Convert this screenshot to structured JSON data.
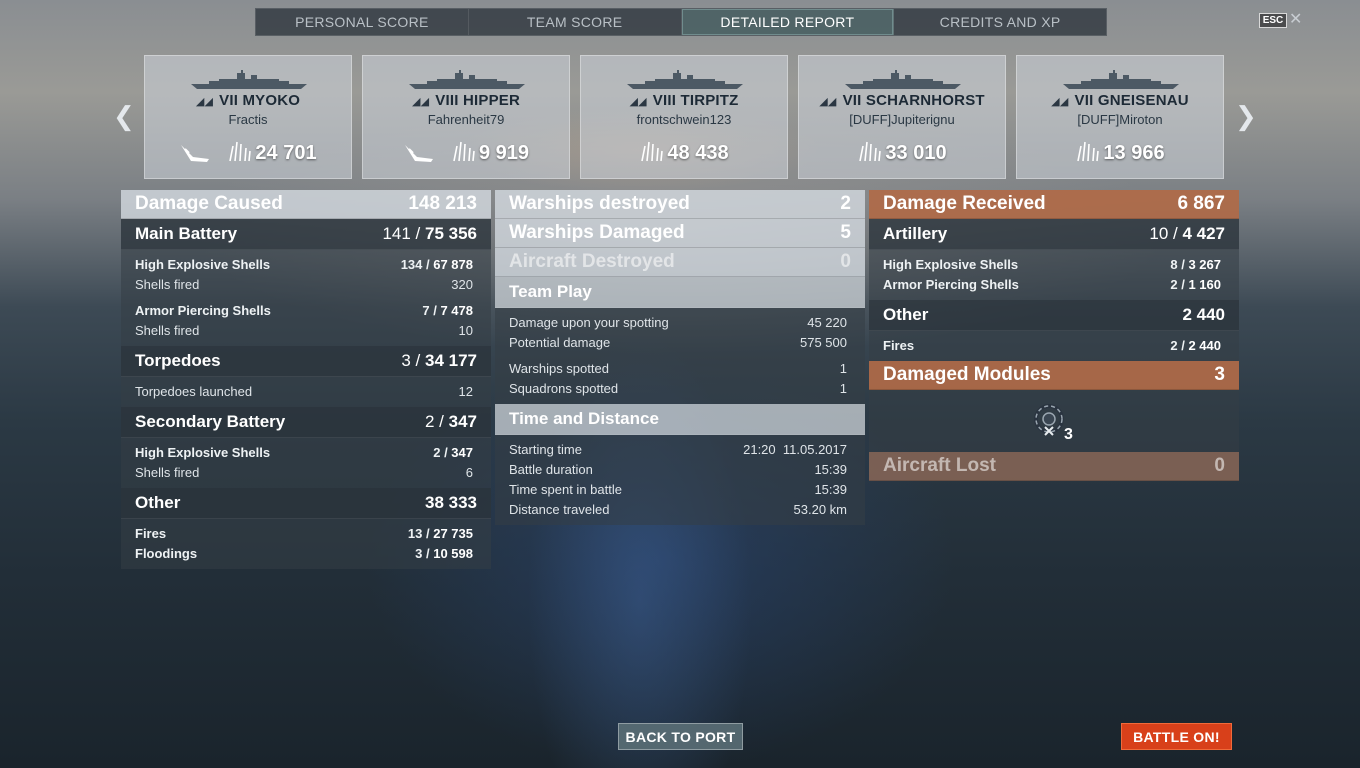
{
  "tabs": [
    {
      "label": "PERSONAL SCORE"
    },
    {
      "label": "TEAM SCORE"
    },
    {
      "label": "DETAILED REPORT"
    },
    {
      "label": "CREDITS AND XP"
    }
  ],
  "header": {
    "esc_label": "ESC",
    "close_glyph": "✕"
  },
  "ships": [
    {
      "tier": "VII",
      "name": "MYOKO",
      "player": "Fractis",
      "damage": "24 701",
      "sunk": true
    },
    {
      "tier": "VIII",
      "name": "HIPPER",
      "player": "Fahrenheit79",
      "damage": "9 919",
      "sunk": true
    },
    {
      "tier": "VIII",
      "name": "TIRPITZ",
      "player": "frontschwein123",
      "damage": "48 438",
      "sunk": false
    },
    {
      "tier": "VII",
      "name": "SCHARNHORST",
      "player": "[DUFF]Jupiterignu",
      "damage": "33 010",
      "sunk": false
    },
    {
      "tier": "VII",
      "name": "GNEISENAU",
      "player": "[DUFF]Miroton",
      "damage": "13 966",
      "sunk": false
    }
  ],
  "damage_caused": {
    "label": "Damage Caused",
    "value": "148 213",
    "main_battery": {
      "label": "Main Battery",
      "hits": "141",
      "value": "75 356",
      "he_label": "High Explosive Shells",
      "he_hits": "134",
      "he_value": "67 878",
      "he_fired_label": "Shells fired",
      "he_fired": "320",
      "ap_label": "Armor Piercing Shells",
      "ap_hits": "7",
      "ap_value": "7 478",
      "ap_fired_label": "Shells fired",
      "ap_fired": "10"
    },
    "torpedoes": {
      "label": "Torpedoes",
      "hits": "3",
      "value": "34 177",
      "launched_label": "Torpedoes launched",
      "launched": "12"
    },
    "secondary": {
      "label": "Secondary Battery",
      "hits": "2",
      "value": "347",
      "he_label": "High Explosive Shells",
      "he_hits": "2",
      "he_value": "347",
      "fired_label": "Shells fired",
      "fired": "6"
    },
    "other": {
      "label": "Other",
      "value": "38 333",
      "fires_label": "Fires",
      "fires_hits": "13",
      "fires_value": "27 735",
      "flood_label": "Floodings",
      "flood_hits": "3",
      "flood_value": "10 598"
    }
  },
  "middle": {
    "warships_destroyed_label": "Warships destroyed",
    "warships_destroyed": "2",
    "warships_damaged_label": "Warships Damaged",
    "warships_damaged": "5",
    "aircraft_destroyed_label": "Aircraft Destroyed",
    "aircraft_destroyed": "0",
    "team_play": {
      "label": "Team Play",
      "spotting_dmg_label": "Damage upon your spotting",
      "spotting_dmg": "45 220",
      "potential_label": "Potential damage",
      "potential": "575 500",
      "ws_spotted_label": "Warships spotted",
      "ws_spotted": "1",
      "sq_spotted_label": "Squadrons spotted",
      "sq_spotted": "1"
    },
    "time_distance": {
      "label": "Time and Distance",
      "start_label": "Starting time",
      "start_time": "21:20",
      "start_date": "11.05.2017",
      "duration_label": "Battle duration",
      "duration": "15:39",
      "spent_label": "Time spent in battle",
      "spent": "15:39",
      "distance_label": "Distance traveled",
      "distance": "53.20 km"
    }
  },
  "damage_received": {
    "label": "Damage Received",
    "value": "6 867",
    "artillery": {
      "label": "Artillery",
      "hits": "10",
      "value": "4 427",
      "he_label": "High Explosive Shells",
      "he_hits": "8",
      "he_value": "3 267",
      "ap_label": "Armor Piercing Shells",
      "ap_hits": "2",
      "ap_value": "1 160"
    },
    "other": {
      "label": "Other",
      "value": "2 440",
      "fires_label": "Fires",
      "fires_hits": "2",
      "fires_value": "2 440"
    },
    "modules": {
      "label": "Damaged Modules",
      "value": "3",
      "icon_count": "3"
    },
    "aircraft_lost": {
      "label": "Aircraft Lost",
      "value": "0"
    }
  },
  "buttons": {
    "back_to_port": "BACK TO PORT",
    "battle_on": "BATTLE ON!"
  },
  "colors": {
    "accent_orange": "#b06a48",
    "battle_button": "#d8401a",
    "active_tab": "#5a7878"
  }
}
